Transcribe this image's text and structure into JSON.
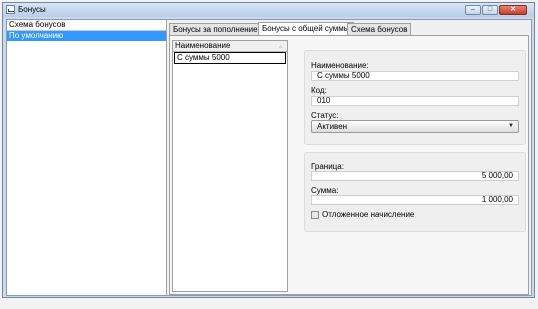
{
  "window": {
    "title": "Бонусы",
    "close_glyph": "✕",
    "minimize_glyph": "–",
    "maximize_glyph": "□"
  },
  "left_panel": {
    "header": "Схема бонусов",
    "items": [
      {
        "label": "По умолчанию",
        "selected": true
      }
    ]
  },
  "tabs": [
    {
      "label": "Бонусы за пополнение",
      "active": false
    },
    {
      "label": "Бонусы с общей суммы",
      "active": true
    },
    {
      "label": "Схема бонусов",
      "active": false
    }
  ],
  "grid": {
    "column_header": "Наименование",
    "sort_icon": "▵",
    "rows": [
      "С суммы 5000"
    ]
  },
  "form": {
    "name_label": "Наименование:",
    "name_value": "С суммы 5000",
    "code_label": "Код:",
    "code_value": "010",
    "status_label": "Статус:",
    "status_value": "Активен",
    "dropdown_glyph": "▼",
    "threshold_label": "Граница:",
    "threshold_value": "5 000,00",
    "amount_label": "Сумма:",
    "amount_value": "1 000,00",
    "deferred_label": "Отложенное начисление",
    "deferred_checked": false
  },
  "colors": {
    "selection": "#3399ff",
    "close_button": "#c2412a",
    "title_bar": "#c9d9ec"
  }
}
